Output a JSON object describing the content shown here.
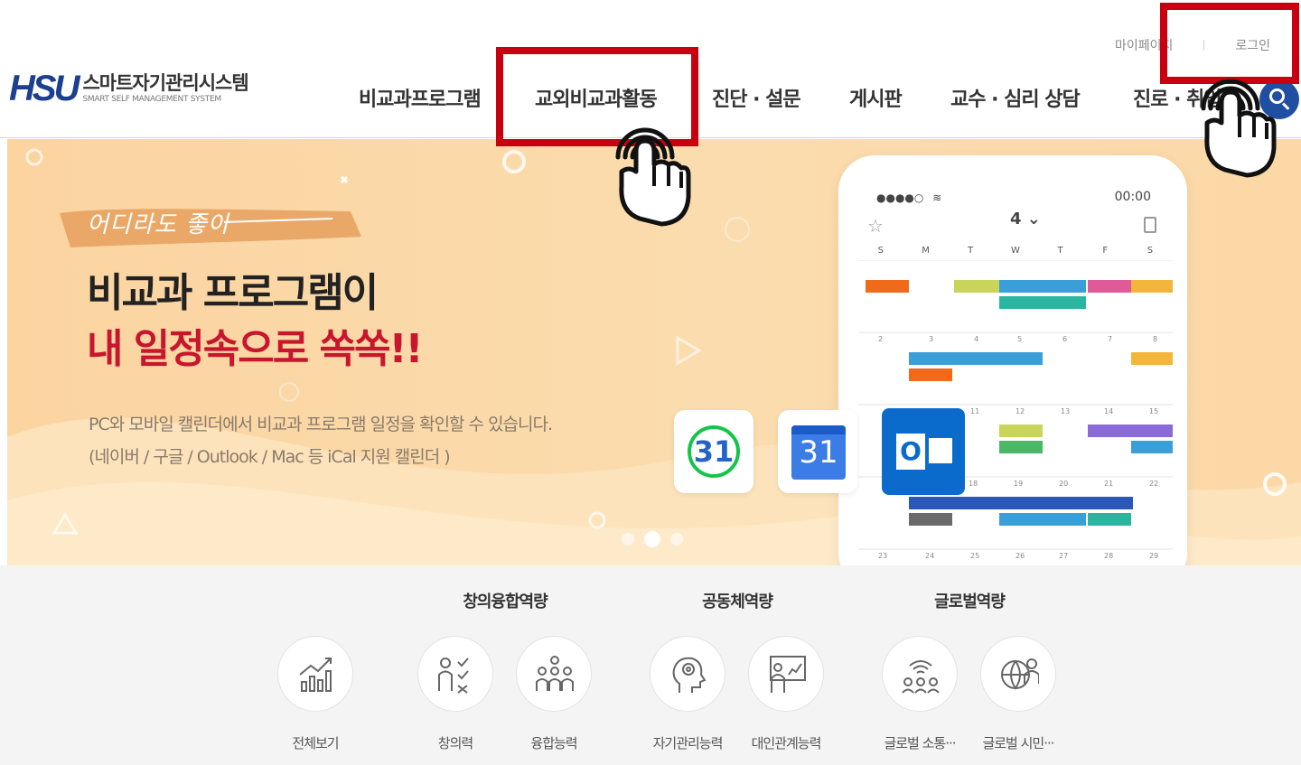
{
  "header": {
    "logo_mark": "HSU",
    "logo_title": "스마트자기관리시스템",
    "logo_subtitle": "SMART SELF MANAGEMENT SYSTEM",
    "util": {
      "mypage": "마이페이지",
      "login": "로그인"
    },
    "nav": [
      {
        "label": "비교과프로그램"
      },
      {
        "label": "교외비교과활동"
      },
      {
        "label": "진단 · 설문"
      },
      {
        "label": "게시판"
      },
      {
        "label": "교수 · 심리 상담"
      },
      {
        "label": "진로 · 취업"
      }
    ],
    "search_icon": "search-icon"
  },
  "hero": {
    "tag": "어디라도 좋아",
    "headline_line1": "비교과 프로그램이",
    "headline_line2": "내 일정속으로 쏙쏙!!",
    "desc_line1": "PC와 모바일 캘린더에서 비교과 프로그램 일정을 확인할 수 있습니다.",
    "desc_line2": "(네이버 / 구글 / Outlook / Mac 등 iCal 지원 캘린더 )",
    "app_icons": [
      {
        "name": "naver-calendar-icon",
        "label": "31"
      },
      {
        "name": "google-calendar-icon",
        "label": "31"
      },
      {
        "name": "outlook-icon",
        "label": "O"
      }
    ],
    "slide_count": 3,
    "active_slide": 2,
    "phone": {
      "carrier": "●●●●○",
      "time": "00:00",
      "month": "4",
      "weekdays": [
        "S",
        "M",
        "T",
        "W",
        "T",
        "F",
        "S"
      ]
    },
    "colors": {
      "background": "#fbd7a2",
      "headline_accent": "#c7162d"
    }
  },
  "competency": {
    "groups": [
      {
        "title": "창의융합역량"
      },
      {
        "title": "공동체역량"
      },
      {
        "title": "글로벌역량"
      }
    ],
    "items": [
      {
        "label": "전체보기",
        "icon": "chart-growth-icon"
      },
      {
        "label": "창의력",
        "icon": "checklist-person-icon"
      },
      {
        "label": "융합능력",
        "icon": "team-icon"
      },
      {
        "label": "자기관리능력",
        "icon": "head-gears-icon"
      },
      {
        "label": "대인관계능력",
        "icon": "presentation-icon"
      },
      {
        "label": "글로벌 소통···",
        "icon": "network-people-icon"
      },
      {
        "label": "글로벌 시민···",
        "icon": "globe-person-icon"
      }
    ]
  },
  "annotations": {
    "highlight_color": "#c8000f",
    "targets": [
      "교외비교과활동",
      "로그인"
    ]
  }
}
